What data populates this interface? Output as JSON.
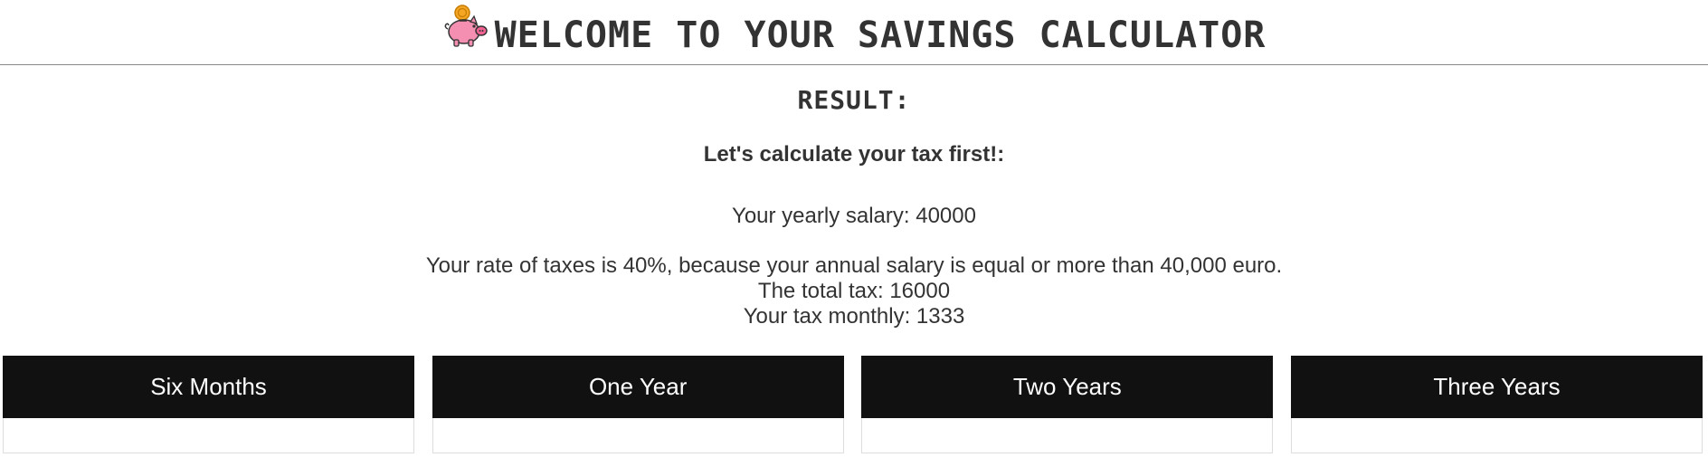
{
  "header": {
    "title": "WELCOME TO YOUR SAVINGS CALCULATOR",
    "logo_icon": "piggy-bank-icon"
  },
  "result": {
    "title": "RESULT:",
    "subtitle": "Let's calculate your tax first!:",
    "salary_line": "Your yearly salary: 40000",
    "rate_line": "Your rate of taxes is 40%, because your annual salary is equal or more than 40,000 euro.",
    "total_tax_line": "The total tax: 16000",
    "monthly_tax_line": "Your tax monthly: 1333"
  },
  "tabs": [
    {
      "label": "Six Months"
    },
    {
      "label": "One Year"
    },
    {
      "label": "Two Years"
    },
    {
      "label": "Three Years"
    }
  ],
  "colors": {
    "text": "#333333",
    "tab_background": "#111111",
    "tab_text": "#ffffff",
    "pig": "#f48fb1",
    "coin": "#f5a623"
  }
}
